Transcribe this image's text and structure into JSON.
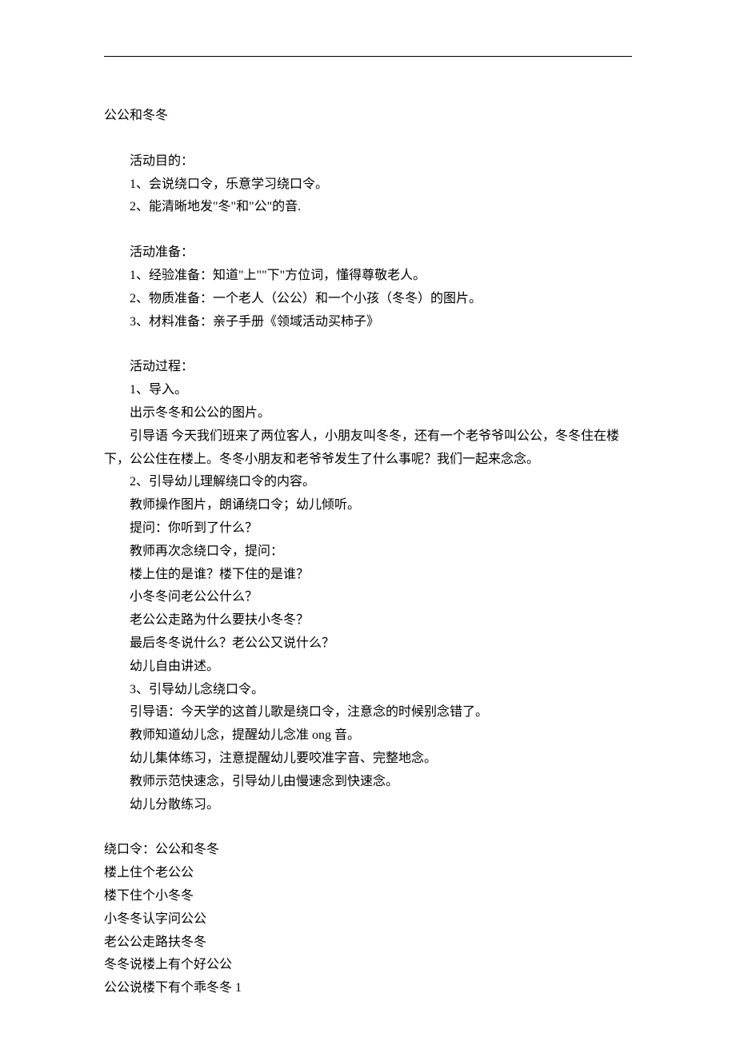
{
  "title": "公公和冬冬",
  "section1": {
    "heading": "活动目的：",
    "items": [
      "1、会说绕口令，乐意学习绕口令。",
      "2、能清晰地发\"冬\"和\"公\"的音."
    ]
  },
  "section2": {
    "heading": "活动准备：",
    "items": [
      "1、经验准备：知道\"上\"\"下\"方位词，懂得尊敬老人。",
      "2、物质准备：一个老人（公公）和一个小孩（冬冬）的图片。",
      "3、材料准备：亲子手册《领域活动买柿子》"
    ]
  },
  "section3": {
    "heading": "活动过程：",
    "lines": [
      "1、导入。",
      "出示冬冬和公公的图片。",
      "引导语 今天我们班来了两位客人，小朋友叫冬冬，还有一个老爷爷叫公公，冬冬住在楼下，公公住在楼上。冬冬小朋友和老爷爷发生了什么事呢？我们一起来念念。",
      "2、引导幼儿理解绕口令的内容。",
      "教师操作图片，朗诵绕口令；幼儿倾听。",
      "提问：你听到了什么？",
      "教师再次念绕口令，提问：",
      "楼上住的是谁？楼下住的是谁？",
      "小冬冬问老公公什么？",
      "老公公走路为什么要扶小冬冬？",
      "最后冬冬说什么？老公公又说什么？",
      "幼儿自由讲述。",
      "3、引导幼儿念绕口令。",
      "引导语：今天学的这首儿歌是绕口令，注意念的时候别念错了。",
      "教师知道幼儿念，提醒幼儿念准 ong 音。",
      "幼儿集体练习，注意提醒幼儿要咬准字音、完整地念。",
      "教师示范快速念，引导幼儿由慢速念到快速念。",
      "幼儿分散练习。"
    ]
  },
  "tongue_twister": {
    "lines": [
      "绕口令：公公和冬冬",
      "楼上住个老公公",
      "楼下住个小冬冬",
      "小冬冬认字问公公",
      "老公公走路扶冬冬",
      "冬冬说楼上有个好公公",
      "公公说楼下有个乖冬冬 1"
    ]
  }
}
